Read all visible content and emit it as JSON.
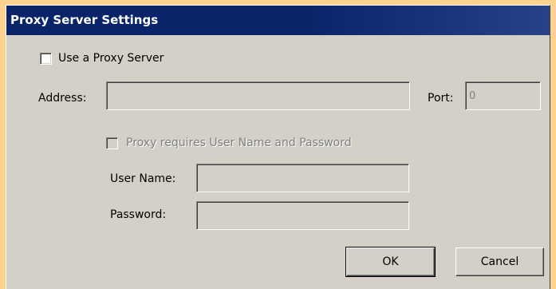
{
  "window": {
    "title": "Proxy Server Settings"
  },
  "proxy": {
    "use_proxy_label": "Use a Proxy Server",
    "use_proxy_checked": false,
    "address_label": "Address:",
    "address_value": "",
    "port_label": "Port:",
    "port_value": "0"
  },
  "auth": {
    "requires_auth_label": "Proxy requires User Name and Password",
    "requires_auth_checked": false,
    "username_label": "User Name:",
    "username_value": "",
    "password_label": "Password:",
    "password_value": ""
  },
  "buttons": {
    "ok_label": "OK",
    "cancel_label": "Cancel"
  },
  "colors": {
    "titlebar": "#0a246a",
    "dialog_bg": "#d4d0c8",
    "desktop_bg": "#fcd28e"
  }
}
